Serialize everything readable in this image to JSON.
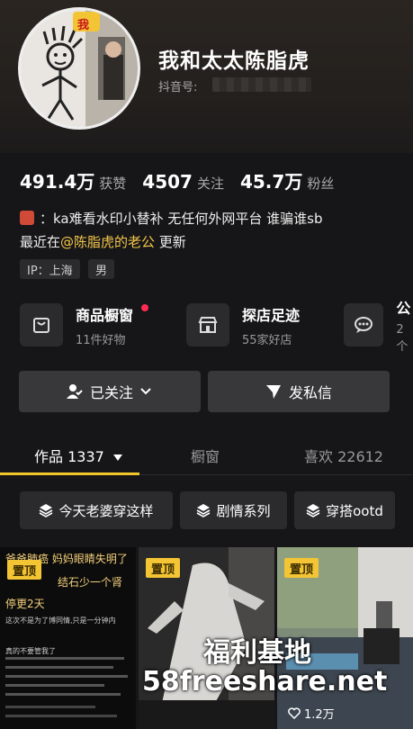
{
  "profile": {
    "nickname": "我和太太陈脂虎",
    "douyin_id_label": "抖音号:",
    "avatar_badge": "我"
  },
  "stats": {
    "likes_num": "491.4万",
    "likes_label": "获赞",
    "following_num": "4507",
    "following_label": "关注",
    "fans_num": "45.7万",
    "fans_label": "粉丝"
  },
  "bio": {
    "line1": "：ka难看水印小替补 无任何外网平台 谁骗谁sb",
    "line2_prefix": "最近在",
    "line2_mention": "@陈脂虎的老公",
    "line2_suffix": " 更新"
  },
  "tags": {
    "ip": "IP：上海",
    "gender": "男"
  },
  "tools": {
    "shop_title": "商品橱窗",
    "shop_sub": "11件好物",
    "store_title": "探店足迹",
    "store_sub": "55家好店",
    "group_title": "公",
    "group_sub": "2个"
  },
  "buttons": {
    "followed_label": "已关注",
    "message_label": "发私信"
  },
  "tabs": {
    "works_label": "作品 1337",
    "showcase_label": "橱窗",
    "liked_label": "喜欢 22612"
  },
  "chips": {
    "chip1": "今天老婆穿这样",
    "chip2": "剧情系列",
    "chip3": "穿搭ootd"
  },
  "thumbs": {
    "t1_pin": "置顶",
    "t1_title1": "爸爸肺癌 妈妈眼睛失明了",
    "t1_title2": "结石少一个肾",
    "t1_title3": "停更2天",
    "t1_body1": "这次不是为了博同情,只是一分钟内",
    "t1_body2": "真的不要管我了",
    "t2_pin": "置顶",
    "t3_pin": "置顶",
    "t3_likes": "1.2万"
  },
  "watermark": {
    "line1": "福利基地",
    "line2": "58freeshare.net"
  },
  "colors": {
    "accent": "#f0c52b",
    "mention": "#f3c54a",
    "background": "#161618",
    "notify": "#ff2b55"
  }
}
